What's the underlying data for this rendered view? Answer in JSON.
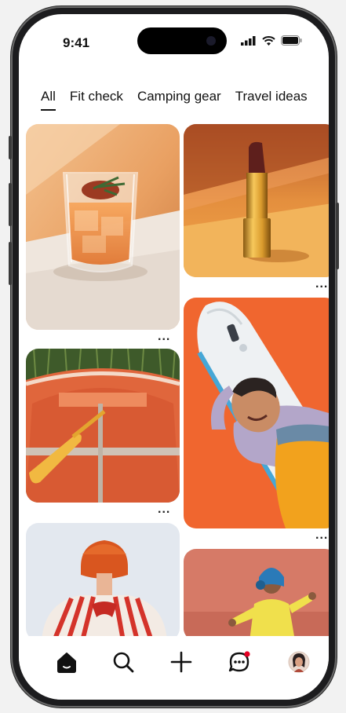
{
  "status_bar": {
    "time": "9:41"
  },
  "tabs": [
    {
      "label": "All",
      "active": true
    },
    {
      "label": "Fit check",
      "active": false
    },
    {
      "label": "Camping gear",
      "active": false
    },
    {
      "label": "Travel ideas",
      "active": false
    }
  ],
  "pins": [
    {
      "subject": "cocktail-glass",
      "more": "..."
    },
    {
      "subject": "lipstick",
      "more": "..."
    },
    {
      "subject": "rowboat",
      "more": "..."
    },
    {
      "subject": "paddleboard-person",
      "more": "..."
    },
    {
      "subject": "red-hair-person",
      "more": ""
    },
    {
      "subject": "runner-headphones",
      "more": ""
    }
  ],
  "bottom_nav": [
    {
      "icon": "home-icon",
      "active": true
    },
    {
      "icon": "search-icon",
      "active": false
    },
    {
      "icon": "plus-icon",
      "active": false
    },
    {
      "icon": "chat-icon",
      "active": false,
      "badge": true
    },
    {
      "icon": "avatar",
      "active": false
    }
  ],
  "colors": {
    "accent_badge": "#e60023",
    "orange": "#f06a37",
    "text": "#111111"
  }
}
